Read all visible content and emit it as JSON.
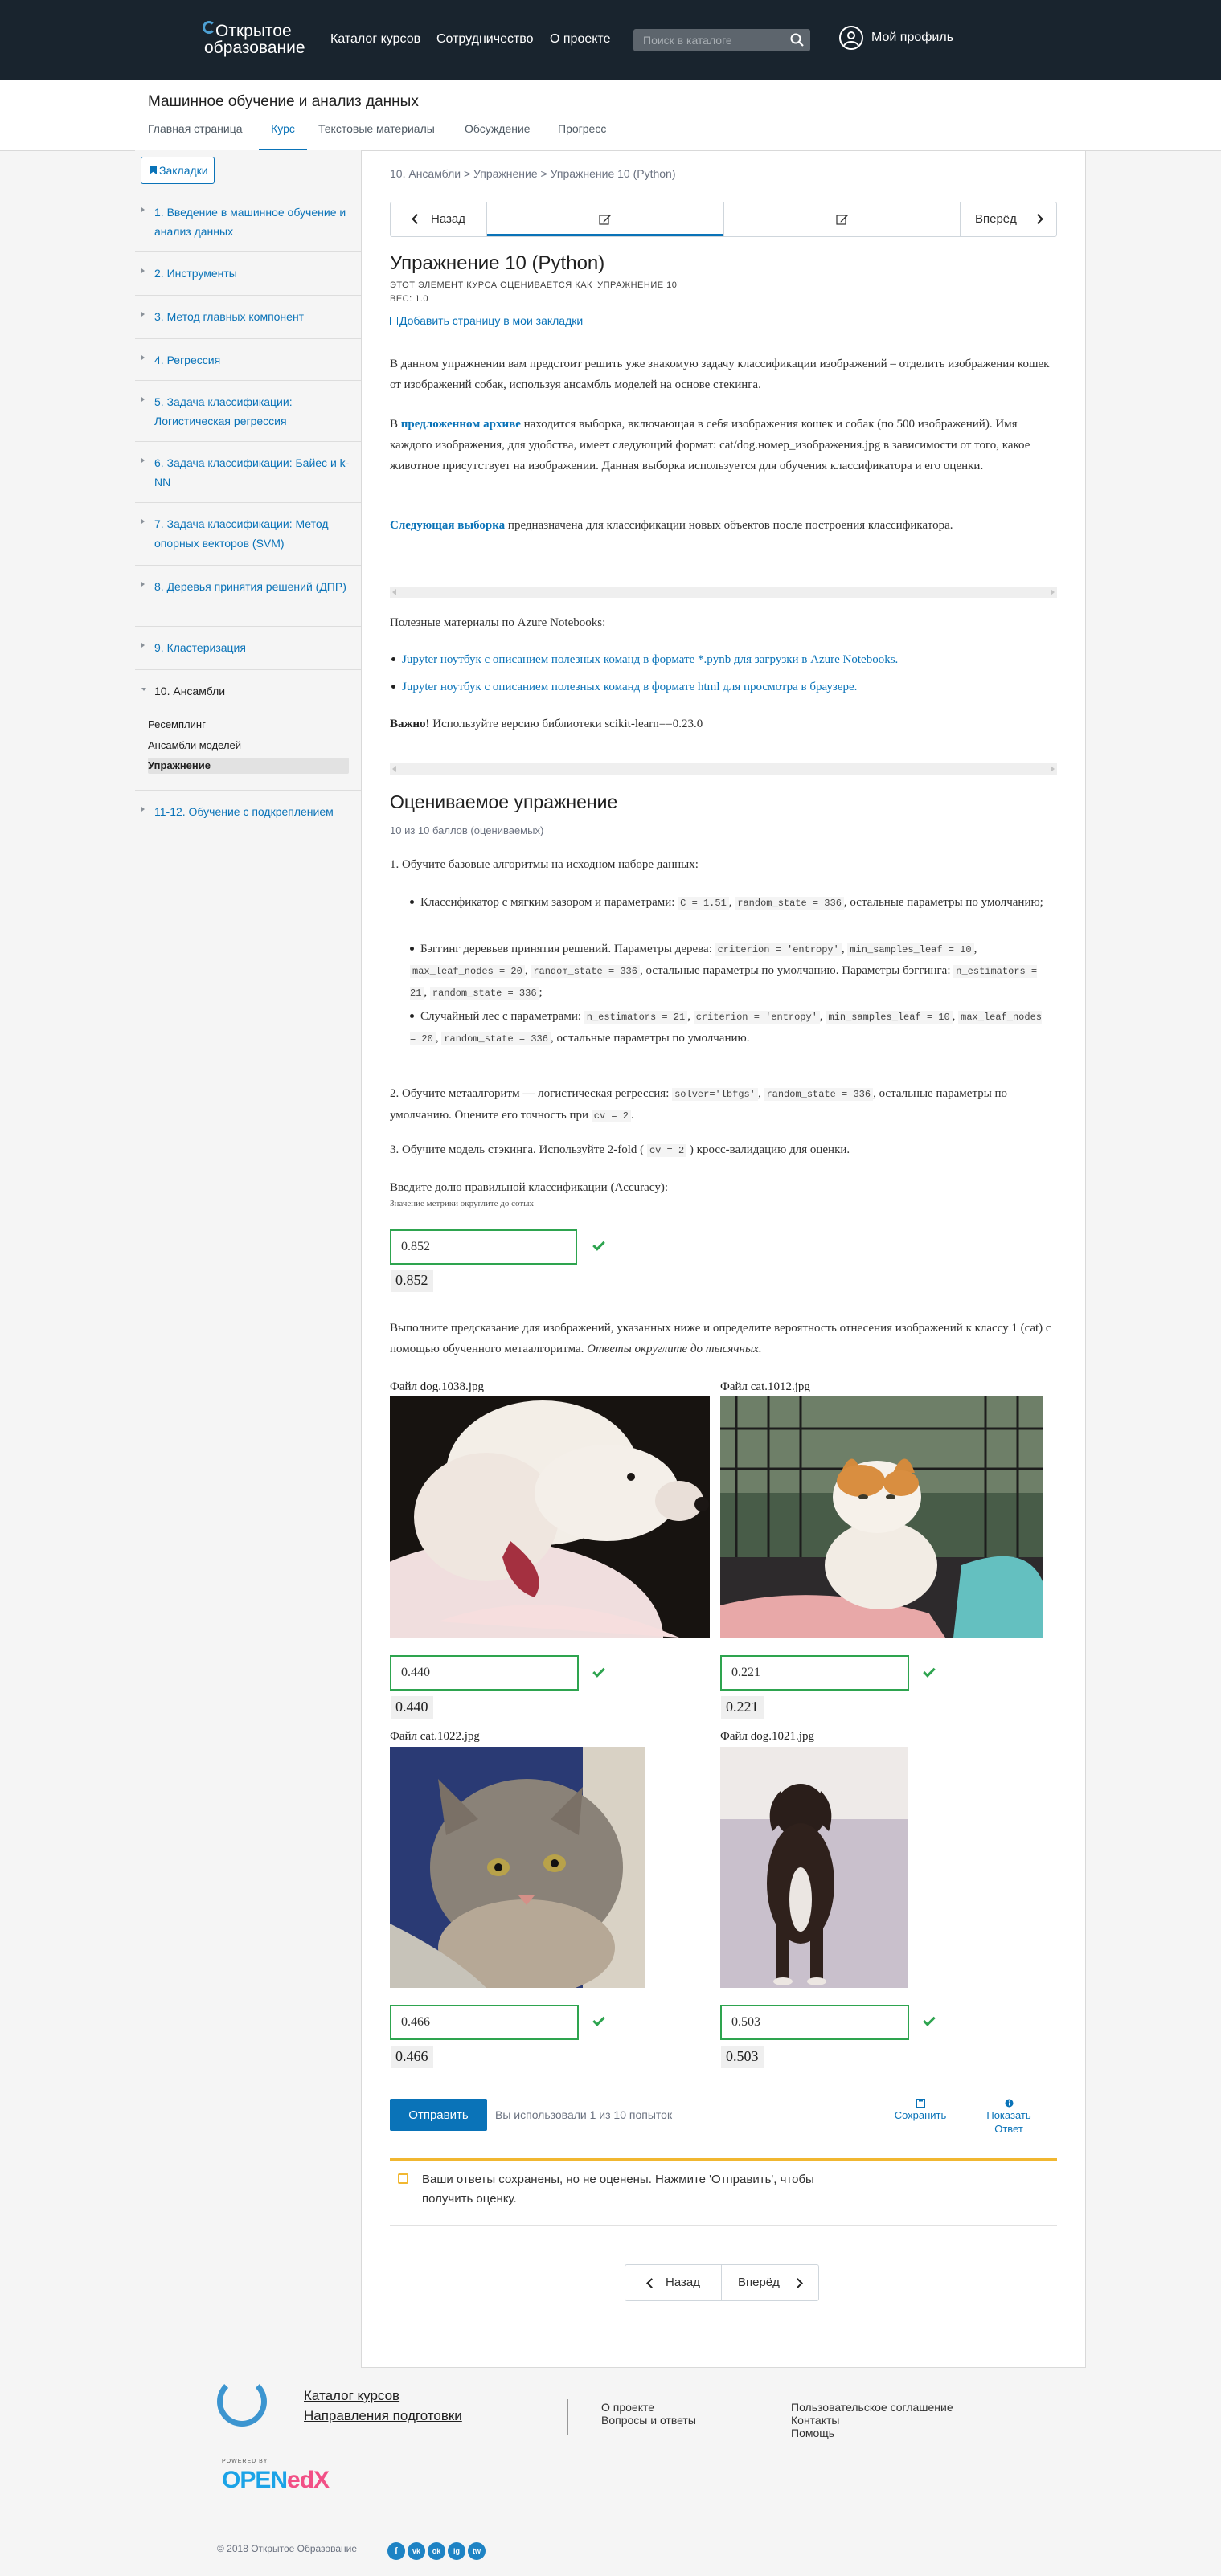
{
  "header": {
    "logo_line1": "Открытое",
    "logo_line2": "образование",
    "nav": [
      "Каталог курсов",
      "Сотрудничество",
      "О проекте"
    ],
    "search_placeholder": "Поиск в каталоге",
    "profile": "Мой профиль"
  },
  "course": {
    "title": "Машинное обучение и анализ данных",
    "tabs": [
      "Главная страница",
      "Курс",
      "Текстовые материалы",
      "Обсуждение",
      "Прогресс"
    ],
    "active_tab": "Курс"
  },
  "sidebar": {
    "bookmarks": "Закладки",
    "items": [
      "1. Введение в машинное обучение и анализ данных",
      "2. Инструменты",
      "3. Метод главных компонент",
      "4. Регрессия",
      "5. Задача классификации: Логистическая регрессия",
      "6. Задача классификации: Байес и k-NN",
      "7. Задача классификации: Метод опорных векторов (SVM)",
      "8. Деревья принятия решений (ДПР)",
      "9. Кластеризация",
      "10. Ансамбли",
      "11-12. Обучение с подкреплением"
    ],
    "subitems": [
      "Ресемплинг",
      "Ансамбли моделей",
      "Упражнение"
    ]
  },
  "content": {
    "breadcrumb": "10. Ансамбли > Упражнение > Упражнение 10 (Python)",
    "prev": "Назад",
    "next": "Вперёд",
    "title": "Упражнение 10 (Python)",
    "graded_note": "ЭТОТ ЭЛЕМЕНТ КУРСА ОЦЕНИВАЕТСЯ КАК 'УПРАЖНЕНИЕ 10'",
    "weight": "ВЕС: 1.0",
    "add_bookmark": "Добавить страницу в мои закладки",
    "intro": "В данном упражнении вам предстоит решить уже знакомую задачу классификации изображений – отделить изображения кошек от изображений собак, используя ансамбль моделей на основе стекинга.",
    "archive_pre": "В ",
    "archive_link": "предложенном архиве",
    "archive_post": " находится выборка, включающая в себя изображения кошек и собак (по 500 изображений). Имя каждого изображения, для удобства, имеет следующий формат: cat/dog.номер_изображения.jpg в зависимости от того, какое животное присутствует на изображении. Данная выборка используется для обучения классификатора и его оценки.",
    "next_link": "Следующая выборка",
    "next_post": " предназначена для классификации новых объектов после построения классификатора.",
    "useful": "Полезные материалы по Azure Notebooks:",
    "bullets": [
      "Jupyter ноутбук с описанием полезных команд в формате *.pynb для загрузки в Azure Notebooks.",
      "Jupyter ноутбук с описанием полезных команд в формате html для просмотра в браузере."
    ],
    "important_b": "Важно!",
    "important": " Используйте версию библиотеки scikit-learn==0.23.0",
    "graded_head": "Оцениваемое упражнение",
    "points": "10 из 10 баллов (оцениваемых)",
    "task1": "1. Обучите базовые алгоритмы на исходном наборе данных:",
    "b1_a": "Классификатор с мягким зазором и параметрами: ",
    "b1_c1": "C = 1.51",
    "b1_c2": "random_state = 336",
    "b1_b": ", остальные параметры по умолчанию;",
    "b2_a": "Бэггинг деревьев принятия решений. Параметры дерева: ",
    "b2_c1": "criterion = 'entropy'",
    "b2_c2": "min_samples_leaf = 10",
    "b2_c3": "max_leaf_nodes = 20",
    "b2_c4": "random_state = 336",
    "b2_b": ", остальные параметры по умолчанию. Параметры бэггинга: ",
    "b2_c5": "n_estimators = 21",
    "b2_c6": "random_state = 336",
    "b3_a": "Случайный лес с параметрами: ",
    "b3_c1": "n_estimators = 21",
    "b3_c2": "criterion = 'entropy'",
    "b3_c3": "min_samples_leaf = 10",
    "b3_c4": "max_leaf_nodes = 20",
    "b3_c5": "random_state = 336",
    "b3_b": ", остальные параметры по умолчанию.",
    "task2_a": "2. Обучите метаалгоритм — логистическая регрессия: ",
    "task2_c1": "solver='lbfgs'",
    "task2_c2": "random_state = 336",
    "task2_b": ", остальные параметры по умолчанию. Оцените его точность при ",
    "task2_c3": "cv = 2",
    "task3_a": "3. Обучите модель стэкинга. Используйте 2-fold ( ",
    "task3_c": "cv = 2",
    "task3_b": " ) кросс-валидацию для оценки.",
    "acc_label": "Введите долю правильной классификации (Accuracy):",
    "acc_hint": "Значение метрики округлите до сотых",
    "acc_value": "0.852",
    "predict_a": "Выполните предсказание для изображений, указанных ниже и определите вероятность отнесения изображений к классу 1 (cat) с помощью обученного метаалгоритма. ",
    "predict_i": "Ответы округлите до тысячных.",
    "files": [
      {
        "name": "Файл dog.1038.jpg",
        "value": "0.440"
      },
      {
        "name": "Файл cat.1012.jpg",
        "value": "0.221"
      },
      {
        "name": "Файл cat.1022.jpg",
        "value": "0.466"
      },
      {
        "name": "Файл dog.1021.jpg",
        "value": "0.503"
      }
    ],
    "submit": "Отправить",
    "attempts": "Вы использовали 1 из 10 попыток",
    "save": "Сохранить",
    "show1": "Показать",
    "show2": "Ответ",
    "notice": "Ваши ответы сохранены, но не оценены. Нажмите 'Отправить', чтобы получить оценку."
  },
  "footer": {
    "links1": [
      "Каталог курсов",
      "Направления подготовки"
    ],
    "links2": [
      "О проекте",
      "Вопросы и ответы"
    ],
    "links3": [
      "Пользовательское соглашение",
      "Контакты",
      "Помощь"
    ],
    "powered": "POWERED BY",
    "openedx_a": "OPEN",
    "openedx_b": "edX",
    "copyright": "© 2018 Открытое Образование",
    "social": [
      "f",
      "vk",
      "ok",
      "ig",
      "tw"
    ]
  },
  "colors": {
    "accent": "#0a73b8",
    "header": "#19242e",
    "ok": "#2ea44f",
    "warn": "#f1b730"
  }
}
